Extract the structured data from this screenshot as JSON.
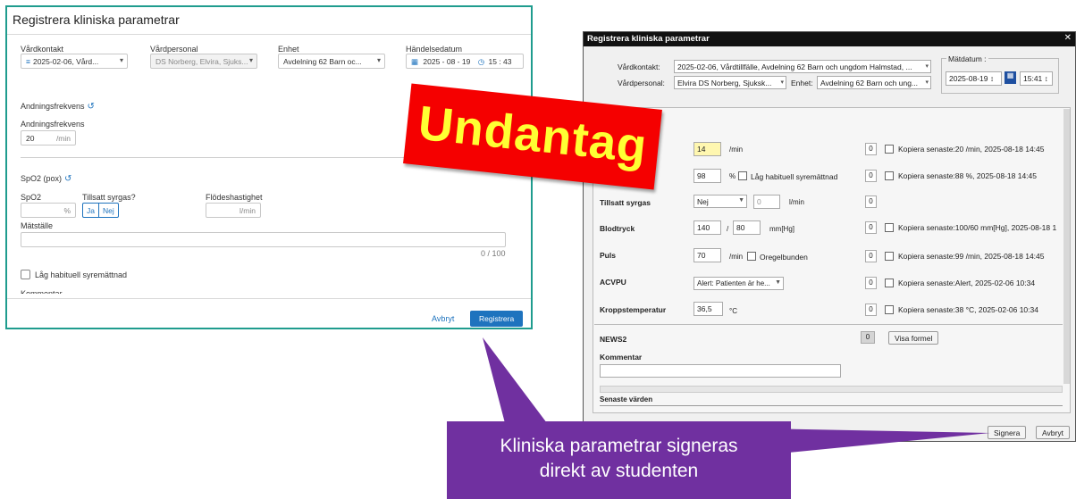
{
  "left_dialog": {
    "title": "Registrera kliniska parametrar",
    "fields": {
      "vardkontakt_label": "Vårdkontakt",
      "vardkontakt_value": "2025-02-06, Vård...",
      "vardpersonal_label": "Vårdpersonal",
      "vardpersonal_value": "DS Norberg, Elvira, Sjuks...",
      "enhet_label": "Enhet",
      "enhet_value": "Avdelning 62 Barn oc...",
      "handelsedatum_label": "Händelsedatum",
      "date_value": "2025 - 08 - 19",
      "time_value": "15 : 43"
    },
    "andning": {
      "section": "Andningsfrekvens",
      "label": "Andningsfrekvens",
      "value": "20",
      "unit": "/min"
    },
    "spo2": {
      "section": "SpO2 (pox)",
      "spo2_label": "SpO2",
      "spo2_unit": "%",
      "syrgas_label": "Tillsatt syrgas?",
      "ja": "Ja",
      "nej": "Nej",
      "flode_label": "Flödeshastighet",
      "flode_unit": "l/min",
      "matstalle_label": "Mätställe",
      "counter": "0 / 100",
      "lag_habituell": "Låg habituell syremättnad",
      "kommentar_partial": "Kommentar"
    },
    "buttons": {
      "cancel": "Avbryt",
      "submit": "Registrera"
    }
  },
  "right_dialog": {
    "title": "Registrera kliniska parametrar",
    "vardkontakt_label": "Vårdkontakt:",
    "vardkontakt_value": "2025-02-06, Vårdtillfälle, Avdelning 62 Barn och ungdom Halmstad, ...",
    "vardpersonal_label": "Vårdpersonal:",
    "vardpersonal_value": "Elvira DS Norberg, Sjuksk...",
    "enhet_label": "Enhet:",
    "enhet_value": "Avdelning 62 Barn och ung...",
    "matdatum_label": "Mätdatum :",
    "date_value": "2025-08-19",
    "time_value": "15:41",
    "rows": {
      "andning": {
        "value": "14",
        "unit": "/min",
        "count": "0",
        "copy": "Kopiera senaste:20 /min, 2025-08-18 14:45"
      },
      "spo2": {
        "value": "98",
        "unit": "%",
        "extra": "Låg habituell syremättnad",
        "count": "0",
        "copy": "Kopiera senaste:88 %, 2025-08-18 14:45"
      },
      "syrgas": {
        "label": "Tillsatt syrgas",
        "value": "Nej",
        "flode": "0",
        "unit": "l/min",
        "count": "0"
      },
      "blodtryck": {
        "label": "Blodtryck",
        "sys": "140",
        "sep": "/",
        "dia": "80",
        "unit": "mm[Hg]",
        "count": "0",
        "copy": "Kopiera senaste:100/60 mm[Hg], 2025-08-18 1"
      },
      "puls": {
        "label": "Puls",
        "value": "70",
        "unit": "/min",
        "extra": "Oregelbunden",
        "count": "0",
        "copy": "Kopiera senaste:99 /min, 2025-08-18 14:45"
      },
      "acvpu": {
        "label": "ACVPU",
        "value": "Alert: Patienten är he...",
        "count": "0",
        "copy": "Kopiera senaste:Alert, 2025-02-06 10:34"
      },
      "temp": {
        "label": "Kroppstemperatur",
        "value": "36,5",
        "unit": "°C",
        "count": "0",
        "copy": "Kopiera senaste:38 °C, 2025-02-06 10:34"
      }
    },
    "news2": {
      "label": "NEWS2",
      "value": "0",
      "button": "Visa formel"
    },
    "kommentar_label": "Kommentar",
    "senaste": "Senaste värden",
    "buttons": {
      "sign": "Signera",
      "cancel": "Avbryt"
    }
  },
  "callouts": {
    "stamp": "Undantag",
    "note_line1": "Kliniska parametrar signeras",
    "note_line2": "direkt av studenten"
  },
  "colors": {
    "stamp_bg": "#f50000",
    "stamp_text": "#ffff33",
    "note_bg": "#7030a0",
    "primary_blue": "#1e73be",
    "left_border": "#1f9c8e"
  }
}
